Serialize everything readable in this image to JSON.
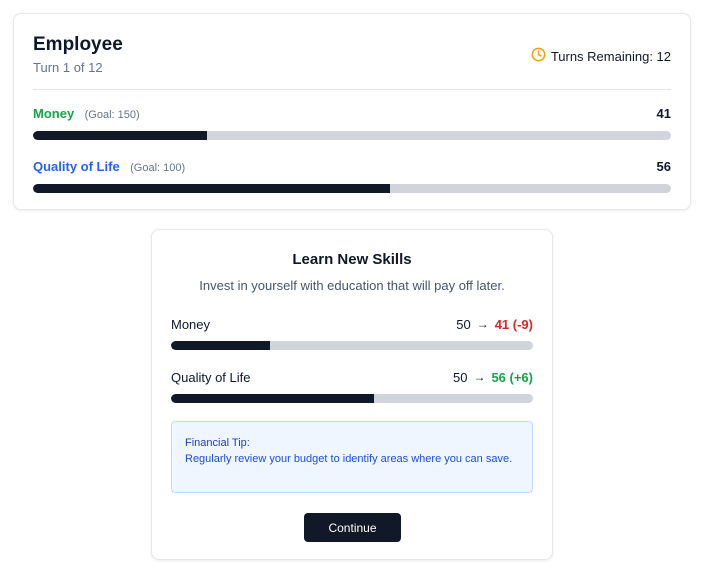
{
  "status": {
    "role": "Employee",
    "turn_text": "Turn 1 of 12",
    "turns_remaining_text": "Turns Remaining: 12",
    "icon": "clock-icon",
    "stats": [
      {
        "name": "Money",
        "goal_text": "(Goal: 150)",
        "value": "41",
        "fill_fraction": 0.273,
        "color": "#16a34a"
      },
      {
        "name": "Quality of Life",
        "goal_text": "(Goal: 100)",
        "value": "56",
        "fill_fraction": 0.56,
        "color": "#2563eb"
      }
    ]
  },
  "skill": {
    "title": "Learn New Skills",
    "description": "Invest in yourself with education that will pay off later.",
    "effects": [
      {
        "name": "Money",
        "from": "50",
        "to": "41 (-9)",
        "direction": "negative",
        "fill_fraction": 0.273
      },
      {
        "name": "Quality of Life",
        "from": "50",
        "to": "56 (+6)",
        "direction": "positive",
        "fill_fraction": 0.56
      }
    ],
    "tip_title": "Financial Tip:",
    "tip_text": "Regularly review your budget to identify areas where you can save.",
    "continue_label": "Continue"
  },
  "colors": {
    "accent_dark": "#111827",
    "money_green": "#16a34a",
    "qol_blue": "#2563eb",
    "negative_red": "#dc2626",
    "clock_amber": "#f59e0b"
  }
}
